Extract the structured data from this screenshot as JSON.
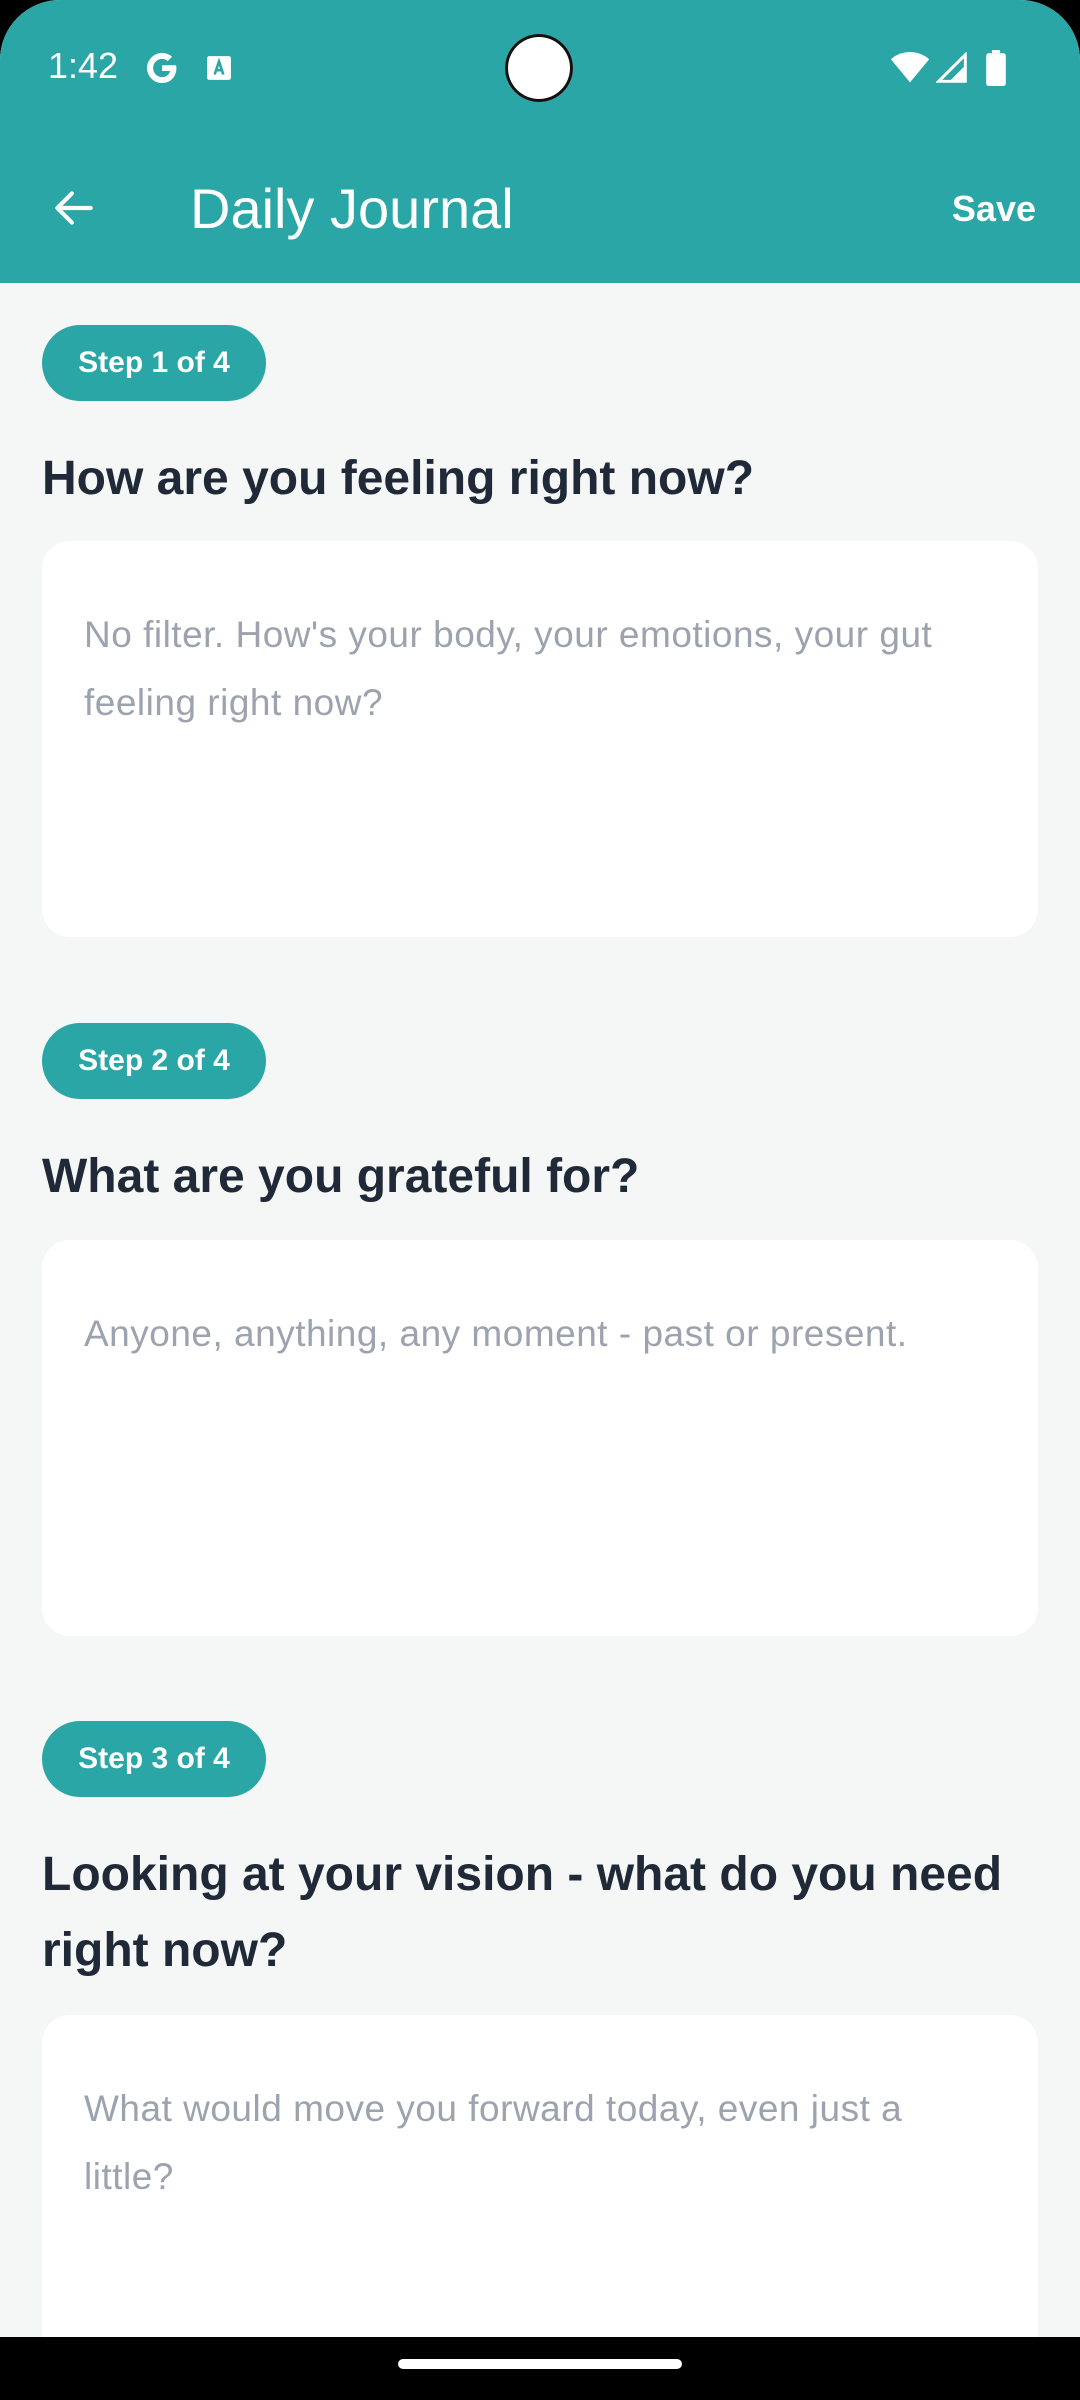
{
  "status_bar": {
    "time": "1:42",
    "icons": [
      "google-icon",
      "translate-icon",
      "wifi-icon",
      "signal-icon",
      "battery-icon"
    ]
  },
  "app_bar": {
    "title": "Daily Journal",
    "save_label": "Save",
    "back_icon": "arrow-left-icon"
  },
  "steps": [
    {
      "badge": "Step 1 of 4",
      "question": "How are you feeling right now?",
      "placeholder": "No filter. How's your body, your emotions, your gut feeling right now?"
    },
    {
      "badge": "Step 2 of 4",
      "question": "What are you grateful for?",
      "placeholder": "Anyone, anything, any moment - past or present."
    },
    {
      "badge": "Step 3 of 4",
      "question": "Looking at your vision - what do you need right now?",
      "placeholder": "What would move you forward today, even just a little?"
    }
  ],
  "colors": {
    "accent": "#29a6a5",
    "background": "#f4f7f5",
    "card": "#ffffff",
    "question_text": "#1f2937",
    "placeholder_text": "#9ca3af"
  }
}
